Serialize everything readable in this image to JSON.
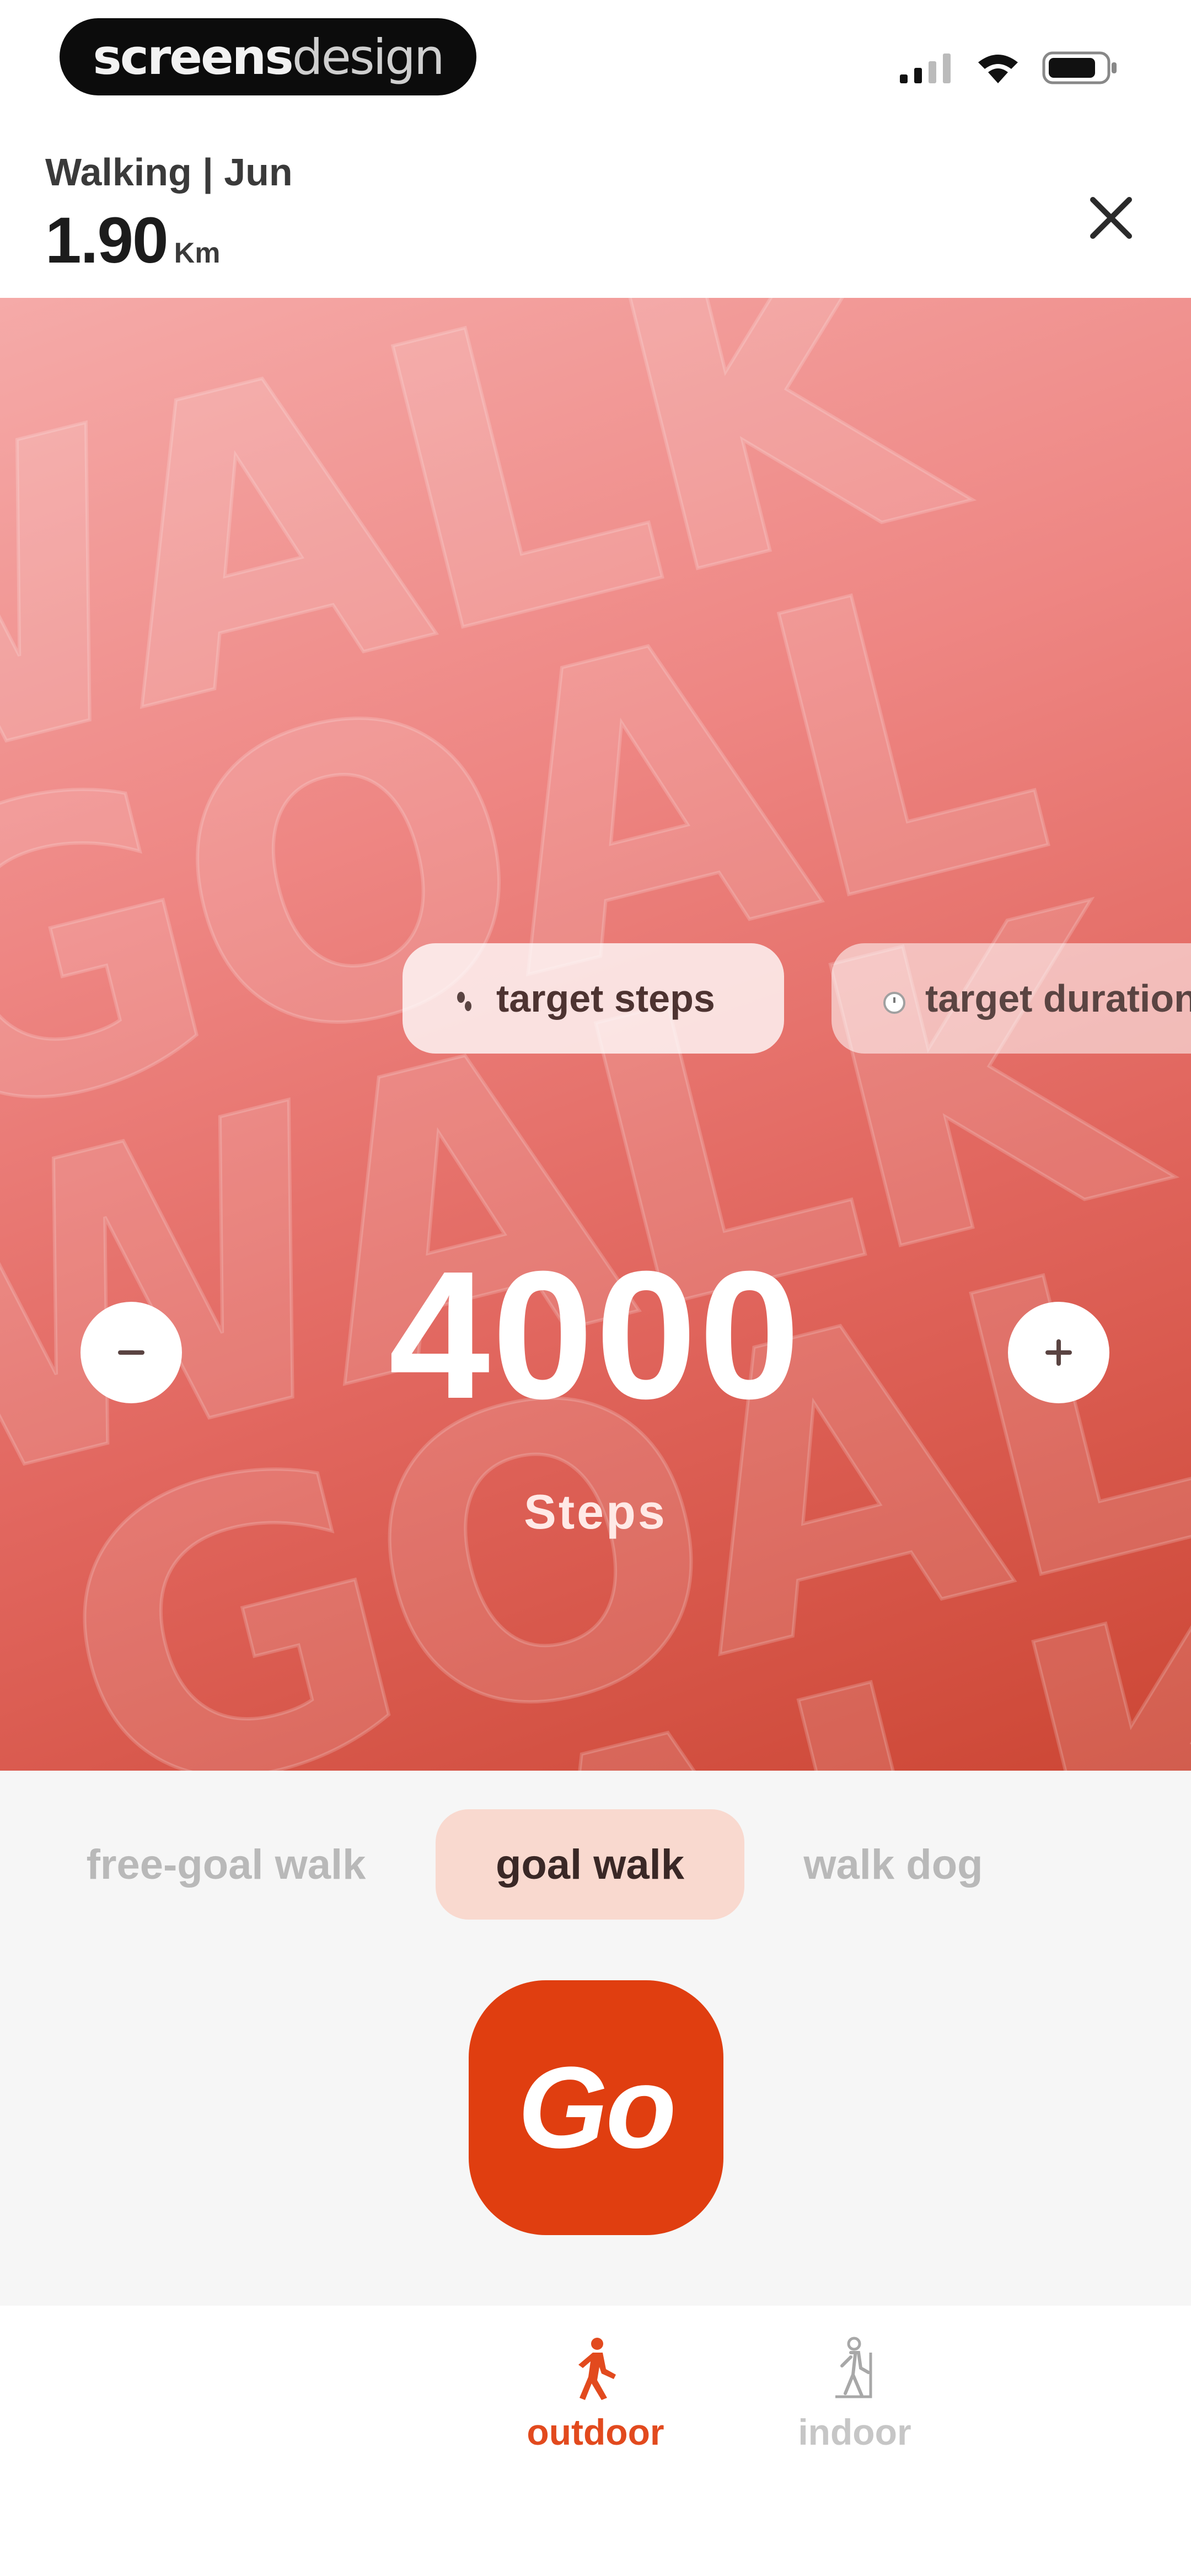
{
  "status_bar": {
    "brand_bold": "screens",
    "brand_light": "design",
    "icons": [
      "signal-icon",
      "wifi-icon",
      "battery-icon"
    ]
  },
  "header": {
    "activity": "Walking | Jun",
    "distance_value": "1.90",
    "distance_unit": "Km",
    "close_icon": "close-icon"
  },
  "hero": {
    "background_words": [
      "WALK",
      "GOAL"
    ],
    "chips": [
      {
        "label": "target steps",
        "icon": "steps-icon",
        "selected": true
      },
      {
        "label": "target duration",
        "icon": "clock-icon",
        "selected": false
      }
    ],
    "goal_value": "4000",
    "goal_unit": "Steps",
    "decrement_icon": "minus-icon",
    "increment_icon": "plus-icon"
  },
  "modes": {
    "items": [
      {
        "label": "free-goal walk",
        "selected": false
      },
      {
        "label": "goal walk",
        "selected": true
      },
      {
        "label": "walk dog",
        "selected": false
      }
    ],
    "go_label": "Go"
  },
  "tabs": [
    {
      "label": "outdoor",
      "icon": "walker-icon",
      "active": true
    },
    {
      "label": "indoor",
      "icon": "treadmill-icon",
      "active": false
    }
  ],
  "colors": {
    "accent": "#e03e10",
    "hero_top": "#f5aaa8",
    "hero_bottom": "#cc4634",
    "active_tab": "#e24a1e",
    "inactive_tab": "#c6c6c6"
  }
}
